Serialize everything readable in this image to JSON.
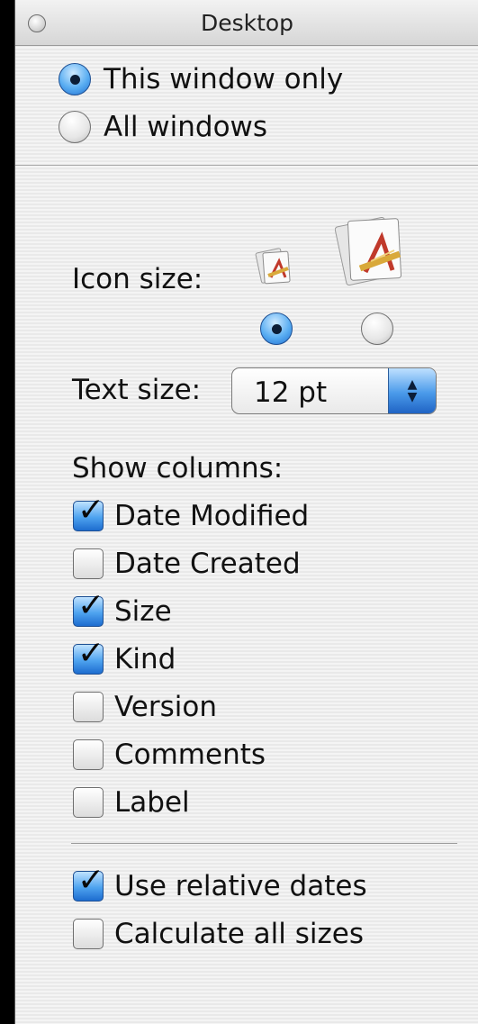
{
  "window": {
    "title": "Desktop"
  },
  "scope": {
    "options": [
      {
        "label": "This window only",
        "selected": true
      },
      {
        "label": "All windows",
        "selected": false
      }
    ]
  },
  "icon_size": {
    "label": "Icon size:",
    "options": [
      {
        "icon": "small-app-document-icon",
        "selected": true
      },
      {
        "icon": "large-app-document-icon",
        "selected": false
      }
    ]
  },
  "text_size": {
    "label": "Text size:",
    "value": "12 pt"
  },
  "columns": {
    "label": "Show columns:",
    "items": [
      {
        "label": "Date Modified",
        "checked": true
      },
      {
        "label": "Date Created",
        "checked": false
      },
      {
        "label": "Size",
        "checked": true
      },
      {
        "label": "Kind",
        "checked": true
      },
      {
        "label": "Version",
        "checked": false
      },
      {
        "label": "Comments",
        "checked": false
      },
      {
        "label": "Label",
        "checked": false
      }
    ]
  },
  "options": {
    "items": [
      {
        "label": "Use relative dates",
        "checked": true
      },
      {
        "label": "Calculate all sizes",
        "checked": false
      }
    ]
  },
  "colors": {
    "accent": "#4ea3ef",
    "window_bg": "#f0f0f0"
  }
}
